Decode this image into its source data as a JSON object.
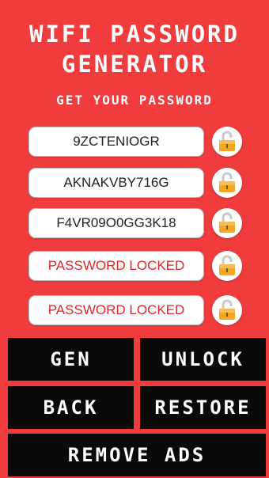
{
  "header": {
    "title_line1": "WIFI PASSWORD",
    "title_line2": "GENERATOR",
    "subtitle": "GET YOUR PASSWORD"
  },
  "passwords": [
    {
      "value": "9ZCTENIOGR",
      "locked": false
    },
    {
      "value": "AKNAKVBY716G",
      "locked": false
    },
    {
      "value": "F4VR09O0GG3K18",
      "locked": false
    },
    {
      "value": "PASSWORD LOCKED",
      "locked": true
    },
    {
      "value": "PASSWORD LOCKED",
      "locked": true
    }
  ],
  "buttons": {
    "gen": "GEN",
    "unlock": "UNLOCK",
    "back": "BACK",
    "restore": "RESTORE",
    "remove_ads": "REMOVE ADS"
  },
  "colors": {
    "background": "#f03c3c",
    "button_bg": "#0a0a0a",
    "locked_text": "#e0262b",
    "lock_icon": "#f4a623"
  },
  "icons": {
    "lock": "padlock-icon"
  }
}
